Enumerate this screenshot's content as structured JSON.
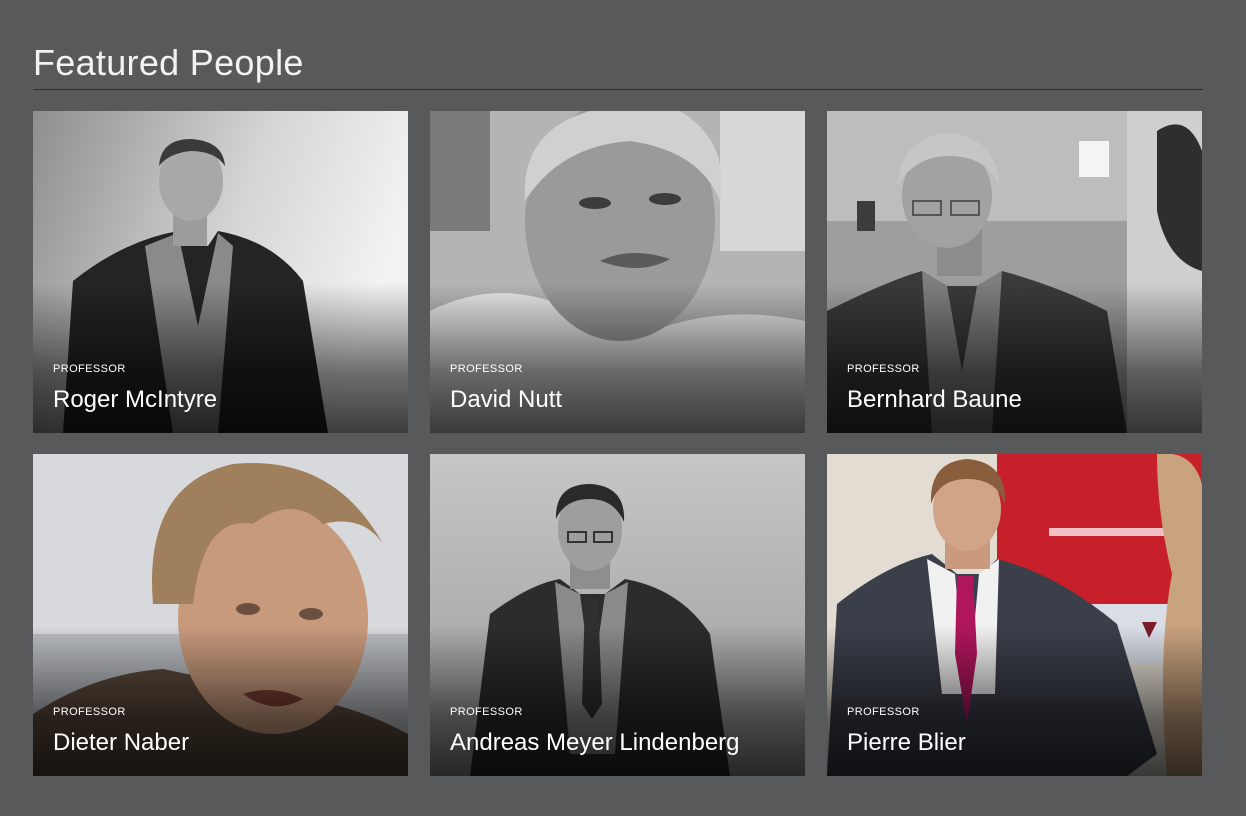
{
  "section": {
    "title": "Featured People"
  },
  "people": [
    {
      "role": "PROFESSOR",
      "name": "Roger McIntyre"
    },
    {
      "role": "PROFESSOR",
      "name": "David Nutt"
    },
    {
      "role": "PROFESSOR",
      "name": "Bernhard Baune"
    },
    {
      "role": "PROFESSOR",
      "name": "Dieter Naber"
    },
    {
      "role": "PROFESSOR",
      "name": "Andreas Meyer Lindenberg"
    },
    {
      "role": "PROFESSOR",
      "name": "Pierre Blier"
    }
  ],
  "colors": {
    "page_background": "#58595b",
    "rule": "#2e2f31",
    "text": "#ffffff",
    "accent_red": "#c8202a",
    "tie_magenta": "#b0165c"
  }
}
